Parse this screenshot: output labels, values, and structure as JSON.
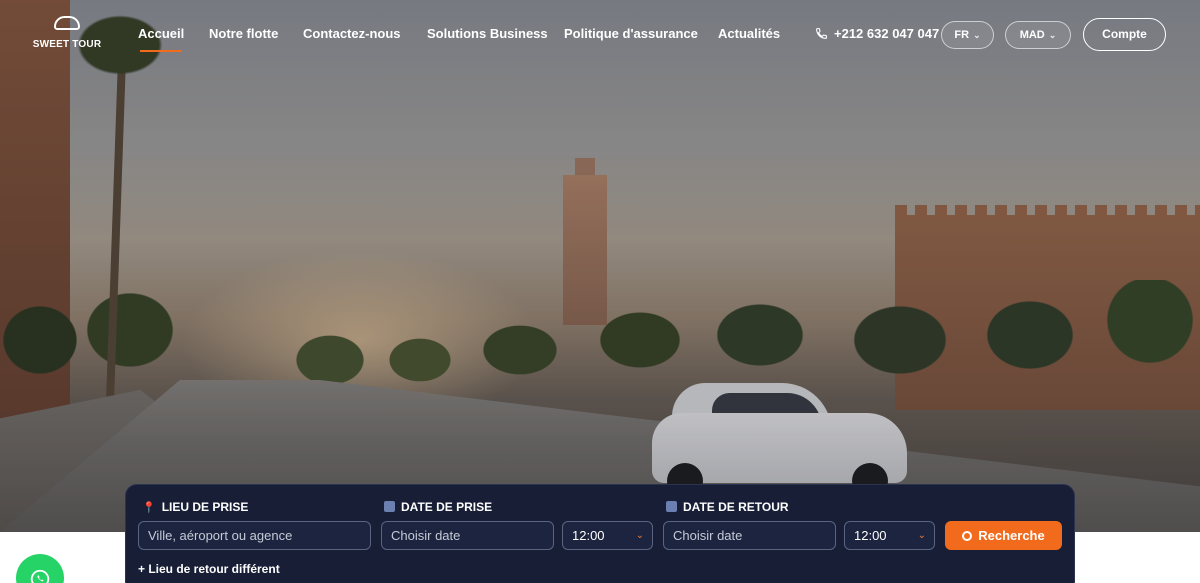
{
  "brand": {
    "name": "SWEET TOUR"
  },
  "nav": {
    "items": [
      {
        "label": "Accueil",
        "active": true
      },
      {
        "label": "Notre flotte"
      },
      {
        "label": "Contactez-nous"
      },
      {
        "label": "Solutions Business"
      },
      {
        "label": "Politique d'assurance"
      },
      {
        "label": "Actualités"
      }
    ],
    "phone": "+212 632 047 047",
    "language": "FR",
    "currency": "MAD",
    "account_label": "Compte"
  },
  "search": {
    "pickup_location_label": "LIEU DE PRISE",
    "pickup_location_placeholder": "Ville, aéroport ou agence",
    "pickup_date_label": "DATE DE PRISE",
    "pickup_date_placeholder": "Choisir date",
    "pickup_time": "12:00",
    "return_date_label": "DATE DE RETOUR",
    "return_date_placeholder": "Choisir date",
    "return_time": "12:00",
    "search_button": "Recherche",
    "different_return_link": "+ Lieu de retour différent"
  },
  "colors": {
    "accent": "#f26b1d",
    "panel": "#171e35",
    "whatsapp": "#25d366"
  },
  "icons": [
    "phone-icon",
    "chevron-down-icon",
    "map-pin-icon",
    "calendar-icon",
    "search-icon",
    "whatsapp-icon"
  ]
}
